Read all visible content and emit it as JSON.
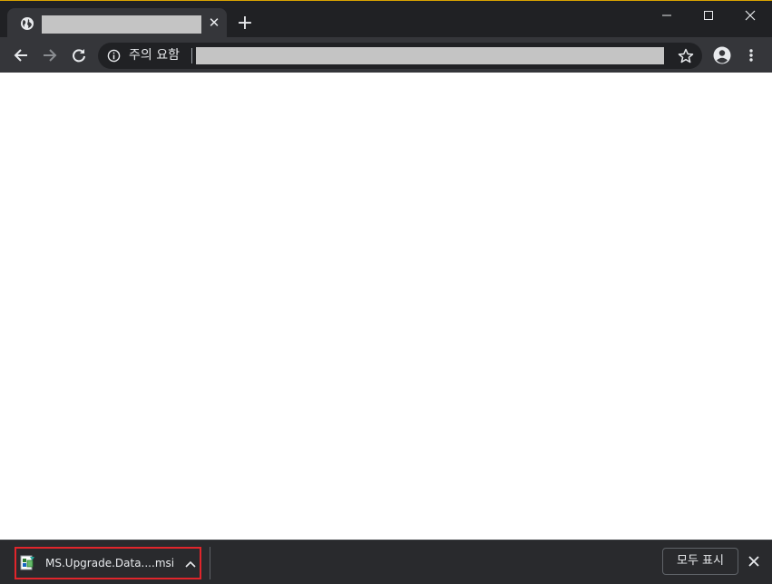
{
  "browser": {
    "tab": {
      "close_glyph": "✕",
      "favicon": "globe-icon"
    },
    "new_tab_glyph": "+",
    "window_controls": [
      "minimize-icon",
      "maximize-icon",
      "close-icon"
    ]
  },
  "toolbar": {
    "back_icon": "arrow-left-icon",
    "forward_icon": "arrow-right-icon",
    "reload_icon": "reload-icon",
    "security_label": "주의 요함",
    "bookmark_icon": "star-icon",
    "profile_icon": "account-circle-icon",
    "menu_icon": "kebab-menu-icon"
  },
  "download_shelf": {
    "item": {
      "filename": "MS.Upgrade.Data....msi",
      "file_icon": "installer-file-icon",
      "chevron_icon": "chevron-up-icon"
    },
    "show_all_label": "모두 표시",
    "close_icon": "close-icon"
  },
  "colors": {
    "titlebar": "#202124",
    "toolbar": "#35363a",
    "content": "#ffffff",
    "highlight": "#e0252b"
  }
}
